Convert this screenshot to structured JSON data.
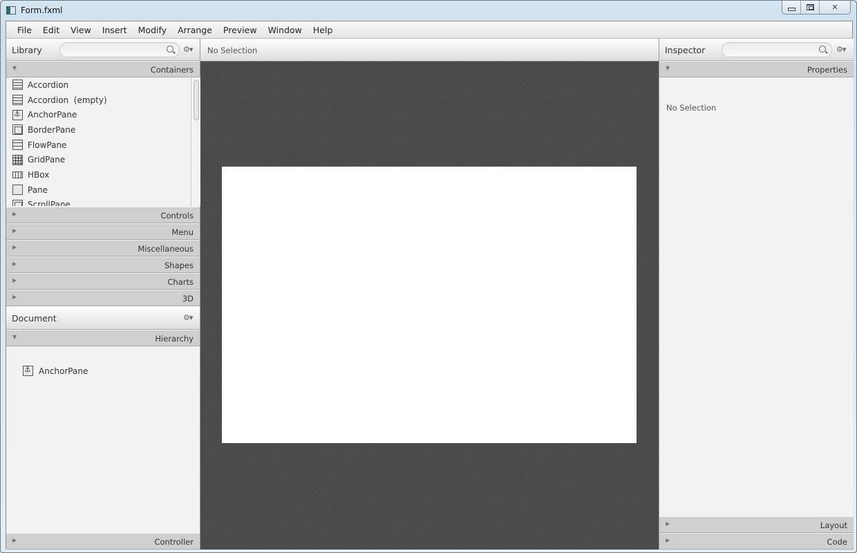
{
  "window": {
    "title": "Form.fxml",
    "controls": [
      "minimize",
      "maximize",
      "close"
    ]
  },
  "menubar": [
    "File",
    "Edit",
    "View",
    "Insert",
    "Modify",
    "Arrange",
    "Preview",
    "Window",
    "Help"
  ],
  "library": {
    "title": "Library",
    "search_placeholder": "",
    "gear": "⚙▾",
    "containers_label": "Containers",
    "items": [
      {
        "label": "Accordion",
        "icon": "accordion-icon"
      },
      {
        "label": "Accordion  (empty)",
        "icon": "accordion-icon"
      },
      {
        "label": "AnchorPane",
        "icon": "anchorpane-icon"
      },
      {
        "label": "BorderPane",
        "icon": "borderpane-icon"
      },
      {
        "label": "FlowPane",
        "icon": "flowpane-icon"
      },
      {
        "label": "GridPane",
        "icon": "gridpane-icon"
      },
      {
        "label": "HBox",
        "icon": "hbox-icon"
      },
      {
        "label": "Pane",
        "icon": "pane-icon"
      },
      {
        "label": "ScrollPane",
        "icon": "scrollpane-icon"
      }
    ],
    "sections": [
      "Controls",
      "Menu",
      "Miscellaneous",
      "Shapes",
      "Charts",
      "3D"
    ]
  },
  "document": {
    "title": "Document",
    "gear": "⚙▾",
    "hierarchy_label": "Hierarchy",
    "hierarchy_items": [
      "AnchorPane"
    ],
    "controller_label": "Controller"
  },
  "center": {
    "selection_status": "No Selection"
  },
  "inspector": {
    "title": "Inspector",
    "search_placeholder": "",
    "gear": "⚙▾",
    "properties_label": "Properties",
    "status": "No Selection",
    "layout_label": "Layout",
    "code_label": "Code"
  },
  "arrows": {
    "expanded": "▼",
    "collapsed": "▶"
  }
}
